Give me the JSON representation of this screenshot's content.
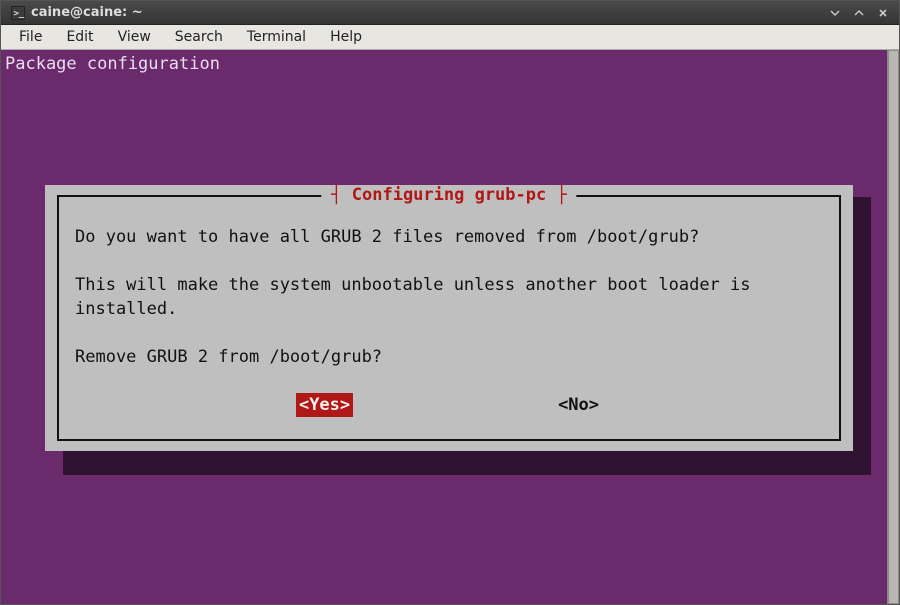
{
  "window": {
    "title": "caine@caine: ~"
  },
  "menubar": {
    "items": [
      {
        "label": "File"
      },
      {
        "label": "Edit"
      },
      {
        "label": "View"
      },
      {
        "label": "Search"
      },
      {
        "label": "Terminal"
      },
      {
        "label": "Help"
      }
    ]
  },
  "terminal": {
    "header_line": "Package configuration"
  },
  "dialog": {
    "title_pre": "┤ ",
    "title_text": "Configuring grub-pc",
    "title_post": " ├",
    "para1": "Do you want to have all GRUB 2 files removed from /boot/grub?",
    "para2": "This will make the system unbootable unless another boot loader is installed.",
    "para3": "Remove GRUB 2 from /boot/grub?",
    "buttons": {
      "yes": "<Yes>",
      "no": "<No>"
    },
    "selected": "yes"
  }
}
